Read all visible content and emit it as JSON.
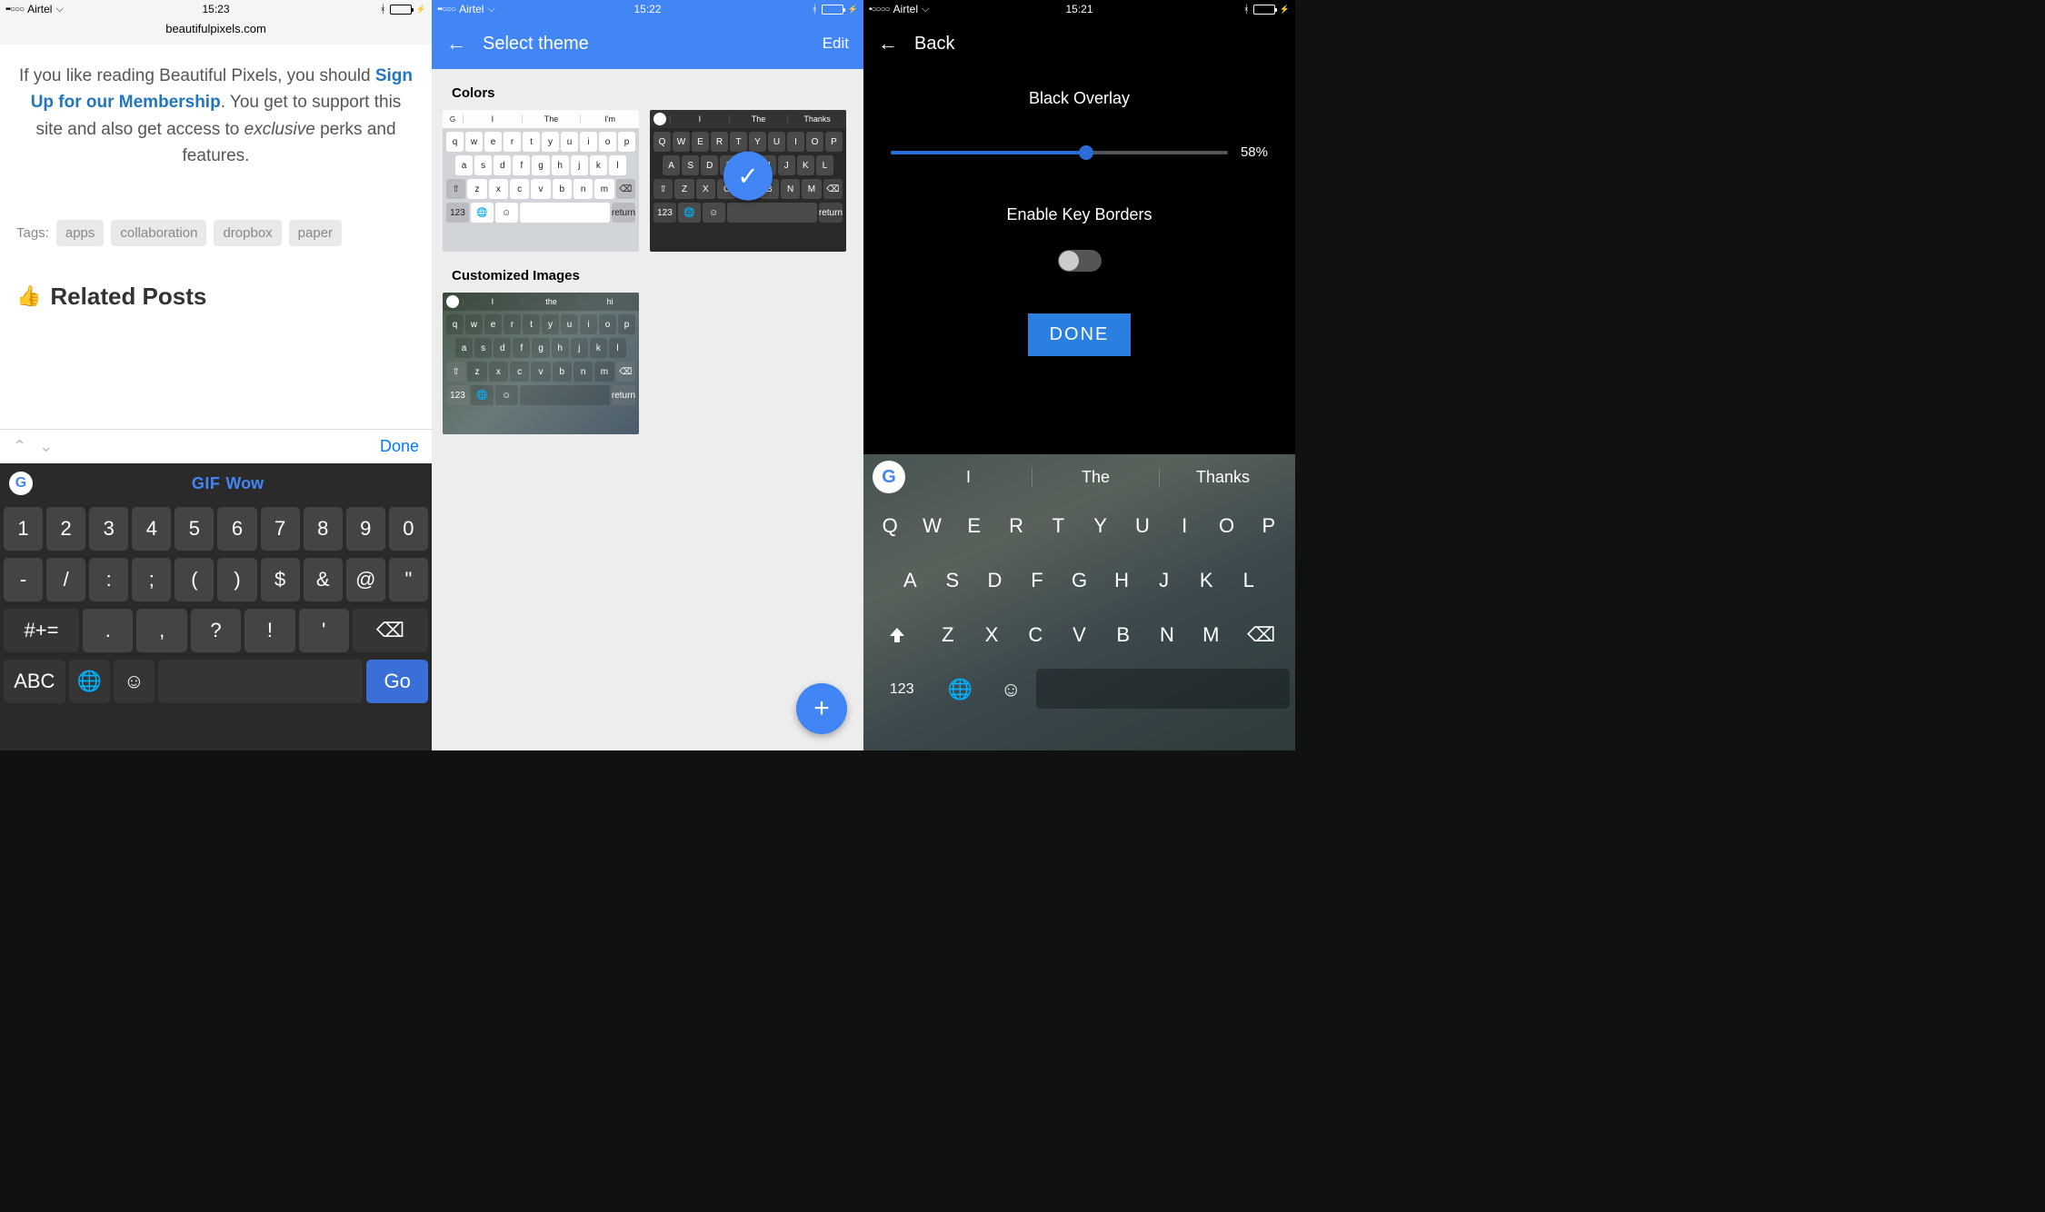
{
  "s1": {
    "status": {
      "carrier": "Airtel",
      "time": "15:23",
      "signal": "••○○○"
    },
    "url": "beautifulpixels.com",
    "promo_pre": "If you like reading Beautiful Pixels, you should ",
    "promo_link": "Sign Up for our Membership",
    "promo_post": ". You get to support this site and also get access to ",
    "promo_em": "exclusive",
    "promo_tail": " perks and features.",
    "tags_label": "Tags:",
    "tags": [
      "apps",
      "collaboration",
      "dropbox",
      "paper"
    ],
    "related_title": "Related Posts",
    "accessory_done": "Done",
    "sugg_gif": "GIF",
    "sugg_word": "Wow",
    "row1": [
      "1",
      "2",
      "3",
      "4",
      "5",
      "6",
      "7",
      "8",
      "9",
      "0"
    ],
    "row2": [
      "-",
      "/",
      ":",
      ";",
      "(",
      ")",
      "$",
      "&",
      "@",
      "\""
    ],
    "row3_sym": "#+=",
    "row3": [
      ".",
      ",",
      "?",
      "!",
      "'"
    ],
    "row4_abc": "ABC",
    "row4_go": "Go"
  },
  "s2": {
    "status": {
      "carrier": "Airtel",
      "time": "15:22",
      "signal": "••○○○"
    },
    "title": "Select theme",
    "edit": "Edit",
    "section_colors": "Colors",
    "section_custom": "Customized Images",
    "thumb_light": {
      "sugg": [
        "I",
        "The",
        "I'm"
      ],
      "row1": [
        "q",
        "w",
        "e",
        "r",
        "t",
        "y",
        "u",
        "i",
        "o",
        "p"
      ],
      "row2": [
        "a",
        "s",
        "d",
        "f",
        "g",
        "h",
        "j",
        "k",
        "l"
      ],
      "row3": [
        "z",
        "x",
        "c",
        "v",
        "b",
        "n",
        "m"
      ],
      "mode": "123",
      "return": "return"
    },
    "thumb_dark": {
      "sugg": [
        "I",
        "The",
        "Thanks"
      ],
      "row1": [
        "Q",
        "W",
        "E",
        "R",
        "T",
        "Y",
        "U",
        "I",
        "O",
        "P"
      ],
      "row2": [
        "A",
        "S",
        "D",
        "F",
        "G",
        "H",
        "J",
        "K",
        "L"
      ],
      "row3": [
        "Z",
        "X",
        "C",
        "V",
        "B",
        "N",
        "M"
      ],
      "mode": "123",
      "return": "return"
    },
    "thumb_img": {
      "sugg": [
        "I",
        "the",
        "hi"
      ],
      "row1": [
        "q",
        "w",
        "e",
        "r",
        "t",
        "y",
        "u",
        "i",
        "o",
        "p"
      ],
      "row2": [
        "a",
        "s",
        "d",
        "f",
        "g",
        "h",
        "j",
        "k",
        "l"
      ],
      "row3": [
        "z",
        "x",
        "c",
        "v",
        "b",
        "n",
        "m"
      ],
      "mode": "123",
      "return": "return"
    }
  },
  "s3": {
    "status": {
      "carrier": "Airtel",
      "time": "15:21",
      "signal": "•○○○○"
    },
    "back": "Back",
    "label_overlay": "Black Overlay",
    "overlay_percent": 58,
    "overlay_percent_text": "58%",
    "label_borders": "Enable Key Borders",
    "done": "DONE",
    "sugg": [
      "I",
      "The",
      "Thanks"
    ],
    "row1": [
      "Q",
      "W",
      "E",
      "R",
      "T",
      "Y",
      "U",
      "I",
      "O",
      "P"
    ],
    "row2": [
      "A",
      "S",
      "D",
      "F",
      "G",
      "H",
      "J",
      "K",
      "L"
    ],
    "row3": [
      "Z",
      "X",
      "C",
      "V",
      "B",
      "N",
      "M"
    ],
    "mode": "123"
  }
}
